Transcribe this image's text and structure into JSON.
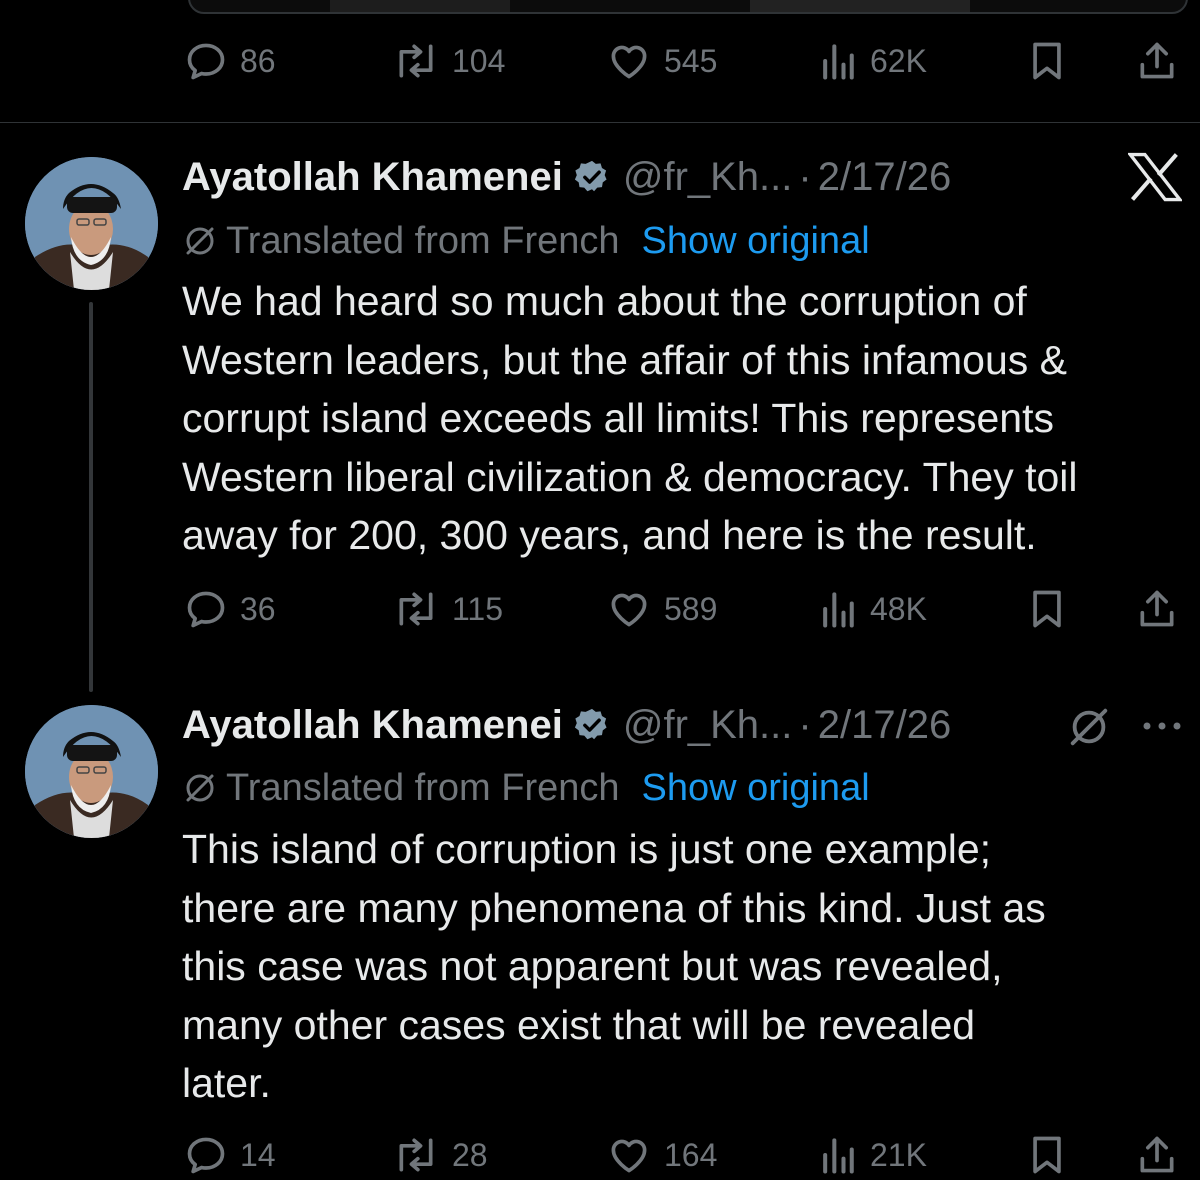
{
  "top_tweet": {
    "stats": {
      "replies": "86",
      "reposts": "104",
      "likes": "545",
      "views": "62K"
    }
  },
  "tweet1": {
    "author_name": "Ayatollah Khamenei",
    "handle": "@fr_Kh...",
    "separator": "·",
    "date": "2/17/26",
    "translated_label": "Translated from French",
    "show_original_label": "Show original",
    "text": "We had heard so much about the corruption of\nWestern leaders, but the affair of this infamous &\ncorrupt island exceeds all limits! This represents\nWestern liberal civilization & democracy. They toil\naway for 200, 300 years, and here is the result.",
    "stats": {
      "replies": "36",
      "reposts": "115",
      "likes": "589",
      "views": "48K"
    }
  },
  "tweet2": {
    "author_name": "Ayatollah Khamenei",
    "handle": "@fr_Kh...",
    "separator": "·",
    "date": "2/17/26",
    "translated_label": "Translated from French",
    "show_original_label": "Show original",
    "text": "This island of corruption is just one example;\nthere are many phenomena of this kind. Just as\nthis case was not apparent but was revealed,\nmany other cases exist that will be revealed\nlater.",
    "stats": {
      "replies": "14",
      "reposts": "28",
      "likes": "164",
      "views": "21K"
    }
  },
  "colors": {
    "background": "#000000",
    "text_primary": "#e7e9ea",
    "text_secondary": "#71767b",
    "accent_link": "#1d9bf0",
    "divider": "#2f3336"
  },
  "icons": [
    "reply-icon",
    "repost-icon",
    "like-icon",
    "views-icon",
    "bookmark-icon",
    "share-icon",
    "verified-badge-icon",
    "x-logo-icon",
    "translate-icon",
    "grok-icon",
    "more-icon"
  ]
}
